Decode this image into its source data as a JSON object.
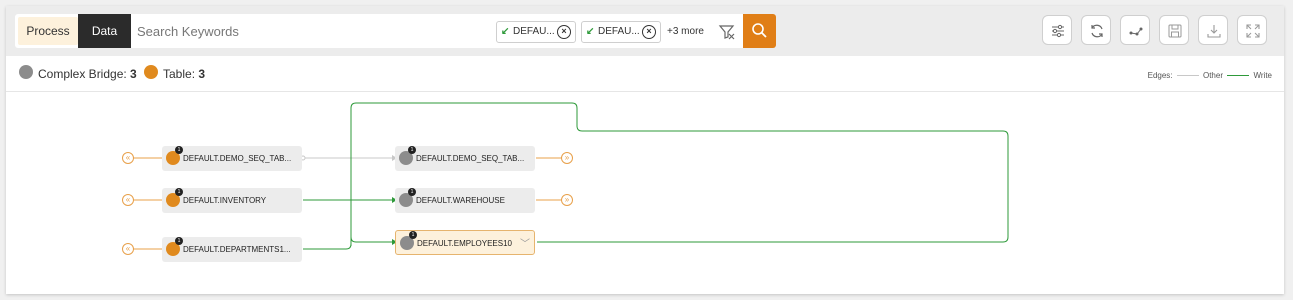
{
  "topbar": {
    "tab_process": "Process",
    "tab_data": "Data",
    "search_placeholder": "Search Keywords",
    "chips": [
      {
        "label": "DEFAU..."
      },
      {
        "label": "DEFAU..."
      }
    ],
    "more_label": "+3 more",
    "search_button_icon": "search-icon",
    "toolbar_icons": [
      "settings-sliders-icon",
      "refresh-icon",
      "lineage-icon",
      "save-icon",
      "download-icon",
      "fullscreen-icon"
    ]
  },
  "legend": {
    "items": [
      {
        "name": "Complex Bridge",
        "count": "3",
        "color": "#8c8c8c"
      },
      {
        "name": "Table",
        "count": "3",
        "color": "#e08a1e"
      }
    ],
    "edges_label": "Edges:",
    "edge_other": "Other",
    "edge_write": "Write",
    "edge_other_color": "#c8c8c8",
    "edge_write_color": "#2e9a3a"
  },
  "graph": {
    "left_nodes": [
      {
        "label": "DEFAULT.DEMO_SEQ_TAB...",
        "badge": "1"
      },
      {
        "label": "DEFAULT.INVENTORY",
        "badge": "1"
      },
      {
        "label": "DEFAULT.DEPARTMENTS1...",
        "badge": "1"
      }
    ],
    "right_nodes": [
      {
        "label": "DEFAULT.DEMO_SEQ_TAB...",
        "badge": "1"
      },
      {
        "label": "DEFAULT.WAREHOUSE",
        "badge": "1"
      },
      {
        "label": "DEFAULT.EMPLOYEES10",
        "badge": "1",
        "selected": true
      }
    ]
  },
  "colors": {
    "accent": "#e07e16",
    "table_node": "#e08a1e",
    "bridge_node": "#8c8c8c",
    "write_edge": "#2e9a3a",
    "other_edge": "#c8c8c8"
  }
}
